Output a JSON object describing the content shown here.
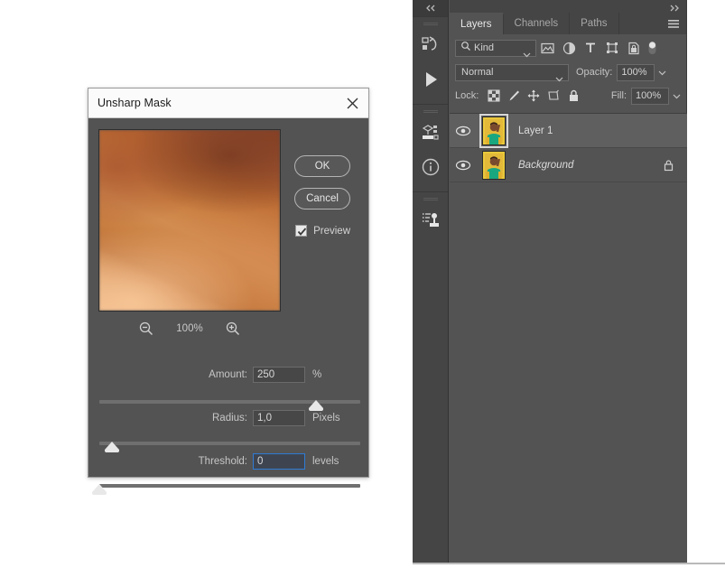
{
  "dialog": {
    "title": "Unsharp Mask",
    "close_icon": "close-icon",
    "preview": {
      "zoom_out_icon": "zoom-out-icon",
      "zoom_in_icon": "zoom-in-icon",
      "zoom_value": "100%"
    },
    "buttons": {
      "ok": "OK",
      "cancel": "Cancel"
    },
    "preview_checkbox": {
      "label": "Preview",
      "checked": true
    },
    "fields": [
      {
        "label": "Amount:",
        "value": "250",
        "unit": "%",
        "slider_percent": 83,
        "focused": false
      },
      {
        "label": "Radius:",
        "value": "1,0",
        "unit": "Pixels",
        "slider_percent": 5,
        "focused": false
      },
      {
        "label": "Threshold:",
        "value": "0",
        "unit": "levels",
        "slider_percent": 0,
        "focused": true
      }
    ]
  },
  "dock": {
    "collapse_icon": "double-chevron-left-icon",
    "expand_icon": "double-chevron-right-icon",
    "rail_groups": [
      {
        "icons": [
          {
            "name": "history-icon"
          },
          {
            "name": "actions-play-icon"
          }
        ]
      },
      {
        "icons": [
          {
            "name": "3d-icon"
          },
          {
            "name": "info-icon"
          }
        ]
      },
      {
        "icons": [
          {
            "name": "clone-source-icon"
          }
        ]
      }
    ],
    "panel": {
      "tabs": [
        {
          "label": "Layers",
          "active": true
        },
        {
          "label": "Channels",
          "active": false
        },
        {
          "label": "Paths",
          "active": false
        }
      ],
      "menu_icon": "panel-menu-icon",
      "filter": {
        "search_icon": "search-icon",
        "kind_label": "Kind",
        "caret_icon": "chevron-down-icon",
        "icons": [
          {
            "name": "filter-pixel-icon"
          },
          {
            "name": "filter-adjustment-icon"
          },
          {
            "name": "filter-type-icon"
          },
          {
            "name": "filter-shape-icon"
          },
          {
            "name": "filter-smart-object-icon"
          }
        ],
        "toggle_icon": "filter-toggle-icon"
      },
      "blend": {
        "mode": "Normal",
        "mode_caret": "chevron-down-icon",
        "opacity_label": "Opacity:",
        "opacity_value": "100%",
        "opacity_caret": "chevron-down-icon"
      },
      "lock": {
        "label": "Lock:",
        "icons": [
          {
            "name": "lock-transparency-icon"
          },
          {
            "name": "lock-image-pixels-icon"
          },
          {
            "name": "lock-position-icon"
          },
          {
            "name": "lock-artboard-icon"
          },
          {
            "name": "lock-all-icon"
          }
        ],
        "fill_label": "Fill:",
        "fill_value": "100%",
        "fill_caret": "chevron-down-icon"
      },
      "layers": [
        {
          "name": "Layer 1",
          "visible": true,
          "selected": true,
          "italic": false,
          "locked": false,
          "eye_icon": "eye-icon",
          "thumbnail": "portrait-thumbnail"
        },
        {
          "name": "Background",
          "visible": true,
          "selected": false,
          "italic": true,
          "locked": true,
          "eye_icon": "eye-icon",
          "lock_icon": "lock-icon",
          "thumbnail": "portrait-thumbnail"
        }
      ]
    }
  },
  "colors": {
    "dialog_bg": "#535353",
    "panel_bg": "#535353",
    "rail_bg": "#454545",
    "titlebar_bg": "#fbfbfb",
    "selected_layer": "#5f5f5f",
    "focus_blue": "#2f7bd4",
    "text_light": "#d8d8d8"
  }
}
